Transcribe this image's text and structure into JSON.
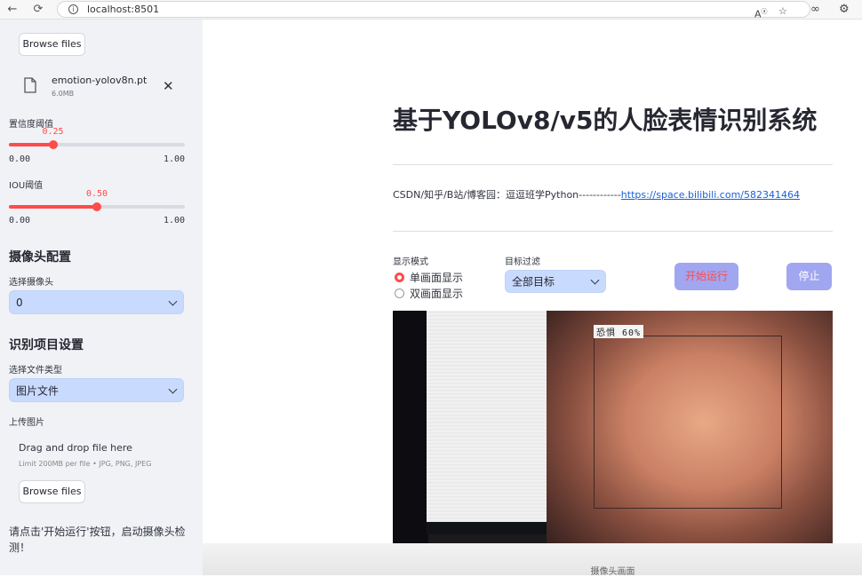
{
  "browser": {
    "url": "localhost:8501"
  },
  "sidebar": {
    "model_browse_label": "Browse files",
    "model_file": {
      "name": "emotion-yolov8n.pt",
      "size": "6.0MB"
    },
    "confidence": {
      "label": "置信度阈值",
      "value": "0.25",
      "value_num": 0.25,
      "min": "0.00",
      "max": "1.00"
    },
    "iou": {
      "label": "IOU阈值",
      "value": "0.50",
      "value_num": 0.5,
      "min": "0.00",
      "max": "1.00"
    },
    "camera_header": "摄像头配置",
    "camera_select_label": "选择摄像头",
    "camera_value": "0",
    "project_header": "识别项目设置",
    "file_type_label": "选择文件类型",
    "file_type_value": "图片文件",
    "upload_label": "上传图片",
    "drop_text": "Drag and drop file here",
    "drop_limit": "Limit 200MB per file • JPG, PNG, JPEG",
    "upload_browse_label": "Browse files",
    "note": "请点击'开始运行'按钮，启动摄像头检测！"
  },
  "main": {
    "title": "基于YOLOv8/v5的人脸表情识别系统",
    "credits_text": "CSDN/知乎/B站/博客园：逗逗班学Python------------",
    "credits_link": "https://space.bilibili.com/582341464",
    "display_mode_label": "显示模式",
    "display_modes": [
      "单画面显示",
      "双画面显示"
    ],
    "filter_label": "目标过滤",
    "filter_value": "全部目标",
    "start_button": "开始运行",
    "stop_button": "停止",
    "detection_label": "恐惧 60%",
    "caption": "摄像头画面"
  },
  "colors": {
    "accent": "#ff4b4b",
    "select_bg": "#c9daff",
    "button_bg": "#a1a6f0"
  }
}
